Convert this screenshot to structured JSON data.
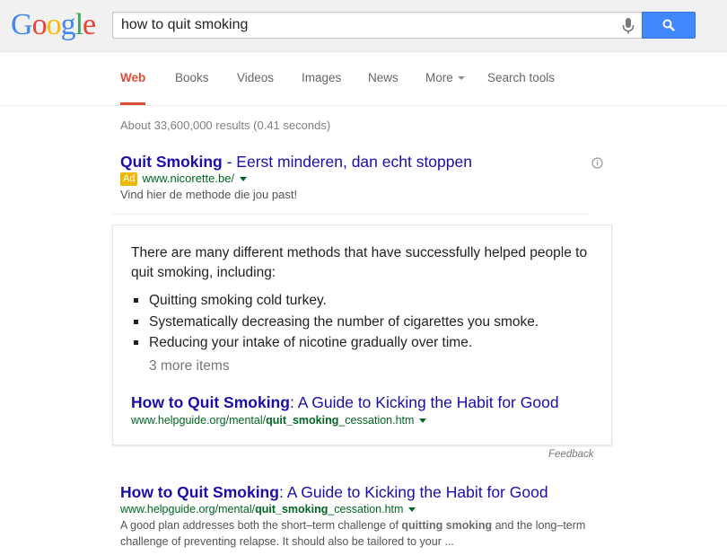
{
  "logo": {
    "letters": [
      "G",
      "o",
      "o",
      "g",
      "l",
      "e"
    ],
    "colors": [
      "#4285f4",
      "#ea4335",
      "#fbbc05",
      "#4285f4",
      "#34a853",
      "#ea4335"
    ]
  },
  "search": {
    "query": "how to quit smoking",
    "placeholder": ""
  },
  "tabs": [
    {
      "label": "Web",
      "active": true
    },
    {
      "label": "Books"
    },
    {
      "label": "Videos"
    },
    {
      "label": "Images"
    },
    {
      "label": "News"
    },
    {
      "label": "More"
    },
    {
      "label": "Search tools"
    }
  ],
  "stats": "About 33,600,000 results (0.41 seconds)",
  "ad": {
    "title_bold": "Quit Smoking",
    "title_rest": " - Eerst minderen, dan echt stoppen",
    "badge": "Ad",
    "url": "www.nicorette.be/",
    "description": "Vind hier de methode die jou past!"
  },
  "answer": {
    "text": "There are many different methods that have successfully helped people to quit smoking, including:",
    "items": [
      "Quitting smoking cold turkey.",
      "Systematically decreasing the number of cigarettes you smoke.",
      "Reducing your intake of nicotine gradually over time."
    ],
    "more": "3 more items",
    "link_bold": "How to Quit Smoking",
    "link_rest": ": A Guide to Kicking the Habit for Good",
    "url_pre": "www.helpguide.org/mental/",
    "url_bold": "quit_smoking",
    "url_post": "_cessation.htm"
  },
  "feedback": "Feedback",
  "result": {
    "title_bold": "How to Quit Smoking",
    "title_rest": ": A Guide to Kicking the Habit for Good",
    "url_pre": "www.helpguide.org/mental/",
    "url_bold": "quit_smoking",
    "url_post": "_cessation.htm",
    "desc_1": "A good plan addresses both the short–term challenge of ",
    "desc_bold": "quitting smoking",
    "desc_2": " and the long–term challenge of preventing relapse. It should also be tailored to your ..."
  },
  "colors": {
    "link": "#1a0dab",
    "url": "#006621",
    "active_tab": "#dd4b39",
    "search_button": "#4387fd",
    "ad_badge": "#edb802"
  },
  "icons": {
    "mic": "microphone-icon",
    "search": "search-icon",
    "info": "info-icon"
  }
}
